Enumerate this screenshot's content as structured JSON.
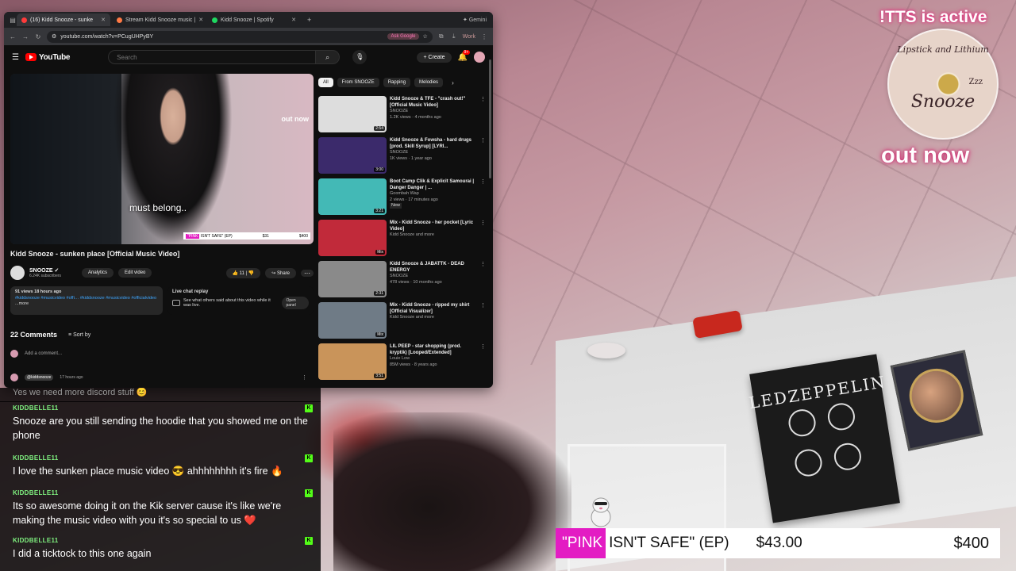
{
  "browser": {
    "tabs": [
      {
        "label": "(16) Kidd Snooze - sunke",
        "color": "#ff3b3b",
        "active": true
      },
      {
        "label": "Stream Kidd Snooze music |",
        "color": "#ff7a45",
        "active": false
      },
      {
        "label": "Kidd Snooze | Spotify",
        "color": "#1ed760",
        "active": false
      }
    ],
    "new_tab": "+",
    "gemini": "✦ Gemini",
    "url": "youtube.com/watch?v=PCugUHPyBY",
    "ask_google": "Ask Google",
    "work": "Work"
  },
  "youtube": {
    "logo_text": "YouTube",
    "search_placeholder": "Search",
    "create_label": "Create",
    "notif_count": "9+",
    "video": {
      "caption": "must belong..",
      "out_now": "out now",
      "ticker_pink": "\"PINK",
      "ticker_title": "ISN'T SAFE\" (EP)",
      "ticker_price": "$31",
      "ticker_goal": "$400"
    },
    "title": "Kidd Snooze - sunken place [Official Music Video]",
    "channel": {
      "name": "SNOOZE",
      "subs": "6.24K subscribers"
    },
    "buttons": {
      "analytics": "Analytics",
      "edit": "Edit video",
      "likes": "11",
      "share": "Share",
      "more": "⋯"
    },
    "description": {
      "meta": "91 views  18 hours ago",
      "tags": "#kiddsnooze #musicvideo #offi… #kiddsnooze #musicvideo #officialvideo",
      "more": "...more"
    },
    "live_chat": {
      "title": "Live chat replay",
      "body": "See what others said about this video while it was live.",
      "button": "Open panel"
    },
    "comments": {
      "count": "22 Comments",
      "sort": "Sort by",
      "add": "Add a comment...",
      "first_handle": "@kiddsnooze",
      "first_time": "17 hours ago"
    },
    "chips": [
      "All",
      "From SNOOZE",
      "Rapping",
      "Melodies"
    ],
    "recommendations": [
      {
        "title": "Kidd Snooze & TFE - \"crash out!\" [Official Music Video]",
        "channel": "SNOOZE",
        "meta": "1.2K views · 4 months ago",
        "duration": "2:54",
        "color": "#ddd"
      },
      {
        "title": "Kidd Snooze & Fowsha - hard drugs [prod. Skill Syrup] [LYRI...",
        "channel": "SNOOZE",
        "meta": "1K views · 1 year ago",
        "duration": "3:00",
        "color": "#3b2a6b"
      },
      {
        "title": "Boot Camp Clik & Explicit Samourai | Danger Danger | ...",
        "channel": "Goombah Wap",
        "meta": "2 views · 17 minutes ago",
        "duration": "3:21",
        "badge": "New",
        "color": "#43b9b6"
      },
      {
        "title": "Mix - Kidd Snooze - her pocket [Lyric Video]",
        "channel": "Kidd Snooze and more",
        "meta": "",
        "duration": "Mix",
        "color": "#c12a3a"
      },
      {
        "title": "Kidd Snooze & JABATTK - DEAD ENERGY",
        "channel": "SNOOZE",
        "meta": "478 views · 10 months ago",
        "duration": "2:31",
        "color": "#8a8a8a"
      },
      {
        "title": "Mix - Kidd Snooze - ripped my shirt [Official Visualizer]",
        "channel": "Kidd Snooze and more",
        "meta": "",
        "duration": "Mix",
        "color": "#6f7b86"
      },
      {
        "title": "LIL PEEP - star shopping (prod. kryptik) [Looped/Extended]",
        "channel": "Louie Low",
        "meta": "85M views · 8 years ago",
        "duration": "3:51",
        "color": "#c9945a"
      }
    ]
  },
  "chat": {
    "cut_text": "Yes we need more discord stuff 😊",
    "messages": [
      {
        "user": "KIDDBELLE11",
        "text": "Snooze are you still sending the hoodie that you showed me on the phone"
      },
      {
        "user": "KIDDBELLE11",
        "text": "I love the sunken place music video 😎 ahhhhhhhh it's fire 🔥"
      },
      {
        "user": "KIDDBELLE11",
        "text": "Its so awesome doing it on the Kik server cause it's like we're making the music video with you it's so special to us ❤️"
      },
      {
        "user": "KIDDBELLE11",
        "text": "I did a ticktock to this one again"
      }
    ],
    "badge": "K"
  },
  "overlay": {
    "tts": "!TTS is active",
    "album_line1": "Lipstick and Lithium",
    "album_line2": "Snooze",
    "album_zzz": "Zzz",
    "out_now": "out now",
    "ticker": {
      "pink": "\"PINK",
      "title": "ISN'T SAFE\" (EP)",
      "price": "$43.00",
      "goal": "$400"
    }
  },
  "room": {
    "poster_title": "LEDZEPPELIN"
  }
}
